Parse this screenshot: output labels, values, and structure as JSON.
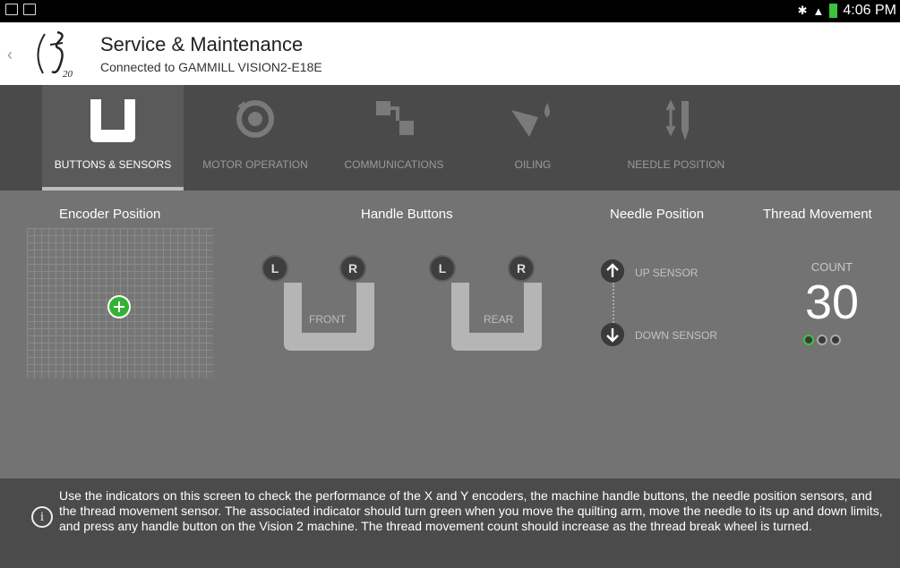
{
  "status_bar": {
    "time": "4:06 PM",
    "icons": [
      "image-icon",
      "cast-icon",
      "bluetooth-icon",
      "wifi-icon",
      "battery-icon"
    ]
  },
  "header": {
    "title": "Service & Maintenance",
    "subtitle": "Connected to GAMMILL VISION2-E18E"
  },
  "tabs": [
    {
      "label": "BUTTONS & SENSORS",
      "icon": "handle-icon",
      "active": true
    },
    {
      "label": "MOTOR OPERATION",
      "icon": "motor-icon",
      "active": false
    },
    {
      "label": "COMMUNICATIONS",
      "icon": "communications-icon",
      "active": false
    },
    {
      "label": "OILING",
      "icon": "oil-can-icon",
      "active": false
    },
    {
      "label": "NEEDLE POSITION",
      "icon": "needle-icon",
      "active": false
    }
  ],
  "sections": {
    "encoder": "Encoder Position",
    "handle_buttons": "Handle Buttons",
    "needle_position": "Needle Position",
    "thread_movement": "Thread Movement"
  },
  "handles": [
    {
      "left_label": "L",
      "right_label": "R",
      "name": "FRONT"
    },
    {
      "left_label": "L",
      "right_label": "R",
      "name": "REAR"
    }
  ],
  "needle": {
    "up": "UP SENSOR",
    "down": "DOWN SENSOR"
  },
  "thread": {
    "count_label": "COUNT",
    "count": "30",
    "indicator_states": [
      "green",
      "off",
      "off"
    ]
  },
  "colors": {
    "active_green": "#33b233"
  },
  "footer": {
    "info_symbol": "i",
    "text": "Use the indicators on this screen to check the performance of the X and Y encoders, the machine handle buttons, the needle position sensors, and the thread movement sensor. The associated indicator should turn green when you move the quilting arm, move the needle to its up and down limits, and press any handle button on the Vision 2 machine. The thread movement count should increase as the thread break wheel is turned."
  }
}
